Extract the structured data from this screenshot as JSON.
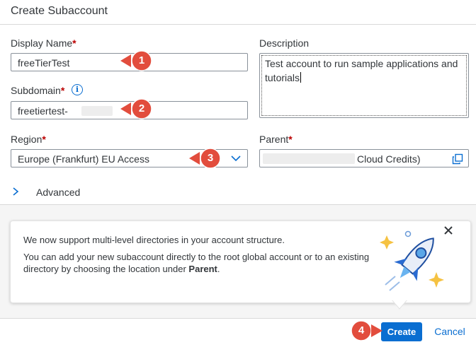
{
  "dialog": {
    "title": "Create Subaccount"
  },
  "form": {
    "display_name": {
      "label": "Display Name",
      "required_mark": "*",
      "value": "freeTierTest"
    },
    "subdomain": {
      "label": "Subdomain",
      "required_mark": "*",
      "value": "freetiertest-",
      "info_icon": "info-icon"
    },
    "region": {
      "label": "Region",
      "required_mark": "*",
      "value": "Europe (Frankfurt) EU Access",
      "icon": "chevron-down-icon"
    },
    "description": {
      "label": "Description",
      "value": "Test account to run sample applications and tutorials"
    },
    "parent": {
      "label": "Parent",
      "required_mark": "*",
      "value": "Cloud Credits)",
      "icon": "copy-icon"
    }
  },
  "advanced": {
    "label": "Advanced",
    "icon": "chevron-right-icon"
  },
  "info_card": {
    "line1": "We now support multi-level directories in your account structure.",
    "line2_prefix": "You can add your new subaccount directly to the root global account or to an existing directory by choosing the location under ",
    "line2_bold": "Parent",
    "line2_suffix": ".",
    "close_icon": "close-icon",
    "illustration": "rocket-illustration"
  },
  "footer": {
    "create_label": "Create",
    "cancel_label": "Cancel"
  },
  "annotations": {
    "step1": "1",
    "step2": "2",
    "step3": "3",
    "step4": "4"
  },
  "colors": {
    "accent": "#0a6ed1",
    "required": "#bb0000",
    "badge": "#e24d3d",
    "text": "#32363a"
  }
}
